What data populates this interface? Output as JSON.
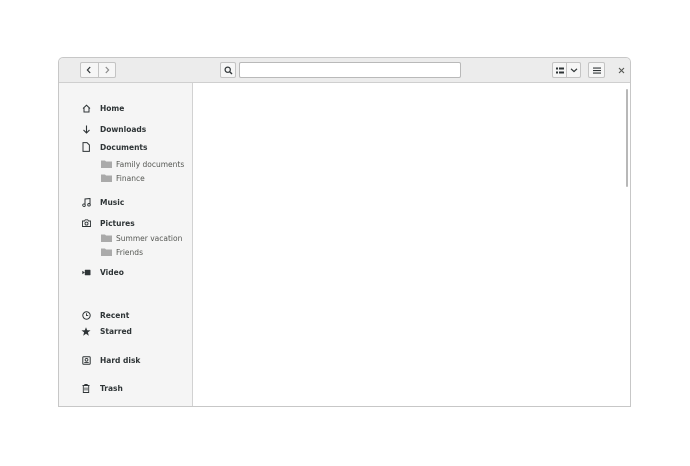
{
  "search": {
    "placeholder": "",
    "value": ""
  },
  "icons": {
    "back": "chevron-left-icon",
    "forward": "chevron-right-icon",
    "search": "search-icon",
    "view": "list-view-icon",
    "view_menu": "chevron-down-icon",
    "main_menu": "hamburger-menu-icon",
    "close": "close-icon"
  },
  "sidebar": {
    "home": "Home",
    "downloads": "Downloads",
    "documents": "Documents",
    "family_documents": "Family documents",
    "finance": "Finance",
    "music": "Music",
    "pictures": "Pictures",
    "summer_vacation": "Summer vacation",
    "friends": "Friends",
    "video": "Video",
    "recent": "Recent",
    "starred": "Starred",
    "hard_disk": "Hard disk",
    "trash": "Trash"
  },
  "colors": {
    "headerbar": "#ececec",
    "sidebar": "#f5f5f5",
    "text": "#2e3436",
    "folder": "#aaaaaa"
  }
}
